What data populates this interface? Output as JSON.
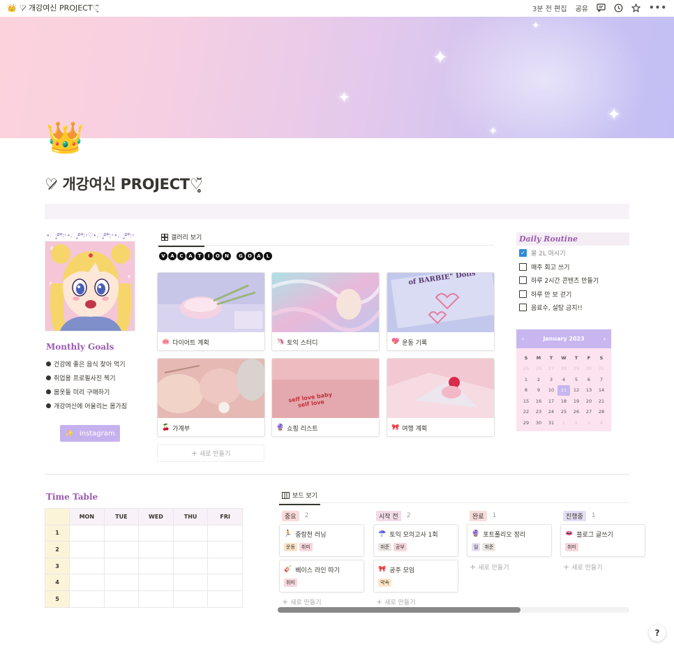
{
  "topbar": {
    "icon": "👑",
    "page_title": "♡̷ 개강여신 PROJECT♡̥̆",
    "edited": "3분 전 편집",
    "share": "공유"
  },
  "page": {
    "icon": "👑",
    "title": "♡̷ 개강여신 PROJECT♡̥̆"
  },
  "deco_line": "⋆.ೃ࿔*:･⋆.ೃ࿔*:･♡⋆.ೃ࿔*:･⋆.ೃ࿔*:･",
  "monthly_goals": {
    "title": "Monthly Goals",
    "items": [
      "건강에 좋은 음식 찾아 먹기",
      "취업용 프로필사진 찍기",
      "봄옷들 미리 구매하기",
      "개강여신에 어울리는 몸가짐"
    ]
  },
  "instagram": {
    "icon": "✨",
    "label": "instagram"
  },
  "gallery": {
    "tab": "갤러리 보기",
    "heading_letters": [
      "V",
      "A",
      "C",
      "A",
      "T",
      "I",
      "O",
      "N",
      " ",
      "G",
      "O",
      "A",
      "L"
    ],
    "cards": [
      {
        "emoji": "🐽",
        "title": "다이어트 계획"
      },
      {
        "emoji": "🦄",
        "title": "토익 스터디"
      },
      {
        "emoji": "💖",
        "title": "운동 기록"
      },
      {
        "emoji": "🍒",
        "title": "가계부"
      },
      {
        "emoji": "🔮",
        "title": "쇼핑 리스트"
      },
      {
        "emoji": "🎀",
        "title": "여행 계획"
      }
    ],
    "new": "새로 만들기",
    "img_text_3": "of BARBIE\" Dolls",
    "img_text_5a": "self love baby",
    "img_text_5b": "self love"
  },
  "routine": {
    "title": "Daily Routine",
    "items": [
      {
        "label": "물 2L 마시기",
        "checked": true
      },
      {
        "label": "매주 회고 쓰기",
        "checked": false
      },
      {
        "label": "하루 2시간 콘텐츠 만들기",
        "checked": false
      },
      {
        "label": "하루 만 보 걷기",
        "checked": false
      },
      {
        "label": "음료수, 설탕 금지!!",
        "checked": false
      }
    ]
  },
  "calendar": {
    "prev": "‹",
    "next": "›",
    "month": "January 2023",
    "dow": [
      "S",
      "M",
      "T",
      "W",
      "T",
      "F",
      "S"
    ],
    "days": [
      {
        "d": "25",
        "m": true
      },
      {
        "d": "26",
        "m": true
      },
      {
        "d": "27",
        "m": true
      },
      {
        "d": "28",
        "m": true
      },
      {
        "d": "29",
        "m": true
      },
      {
        "d": "30",
        "m": true
      },
      {
        "d": "31",
        "m": true
      },
      {
        "d": "1"
      },
      {
        "d": "2"
      },
      {
        "d": "3"
      },
      {
        "d": "4"
      },
      {
        "d": "5"
      },
      {
        "d": "6"
      },
      {
        "d": "7"
      },
      {
        "d": "8"
      },
      {
        "d": "9"
      },
      {
        "d": "10"
      },
      {
        "d": "11",
        "t": true
      },
      {
        "d": "12"
      },
      {
        "d": "13"
      },
      {
        "d": "14"
      },
      {
        "d": "15"
      },
      {
        "d": "16"
      },
      {
        "d": "17"
      },
      {
        "d": "18"
      },
      {
        "d": "19"
      },
      {
        "d": "20"
      },
      {
        "d": "21"
      },
      {
        "d": "22"
      },
      {
        "d": "23"
      },
      {
        "d": "24"
      },
      {
        "d": "25"
      },
      {
        "d": "26"
      },
      {
        "d": "27"
      },
      {
        "d": "28"
      },
      {
        "d": "29"
      },
      {
        "d": "30"
      },
      {
        "d": "31"
      },
      {
        "d": "1",
        "m": true
      },
      {
        "d": "2",
        "m": true
      },
      {
        "d": "3",
        "m": true
      },
      {
        "d": "4",
        "m": true
      }
    ]
  },
  "timetable": {
    "title": "Time Table",
    "days": [
      "MON",
      "TUE",
      "WED",
      "THU",
      "FRI"
    ],
    "rows": [
      "1",
      "2",
      "3",
      "4",
      "5"
    ]
  },
  "board": {
    "tab": "보드 보기",
    "new": "새로 만들기",
    "groups": [
      {
        "label": "중요",
        "count": "2",
        "bg": "#fbdada",
        "cards": [
          {
            "emoji": "🏃",
            "title": "중랑천 러닝",
            "tags": [
              {
                "t": "운동",
                "bg": "#fae3c8"
              },
              {
                "t": "취미",
                "bg": "#f5d6dc"
              }
            ]
          },
          {
            "emoji": "🎸",
            "title": "베이스 라인 따기",
            "tags": [
              {
                "t": "취미",
                "bg": "#f5d6dc"
              }
            ]
          }
        ]
      },
      {
        "label": "시작 전",
        "count": "2",
        "bg": "#f1dce8",
        "cards": [
          {
            "emoji": "☂️",
            "title": "토익 모의고사 1회",
            "tags": [
              {
                "t": "취준",
                "bg": "#ece6e3"
              },
              {
                "t": "공부",
                "bg": "#f5d6dc"
              }
            ]
          },
          {
            "emoji": "🎀",
            "title": "공주 모임",
            "tags": [
              {
                "t": "약속",
                "bg": "#fde6c9"
              }
            ]
          }
        ]
      },
      {
        "label": "완료",
        "count": "1",
        "bg": "#f7dcdc",
        "cards": [
          {
            "emoji": "🔮",
            "title": "포트폴리오 정리",
            "tags": [
              {
                "t": "일",
                "bg": "#e7dff4"
              },
              {
                "t": "취준",
                "bg": "#ece6e3"
              }
            ]
          }
        ]
      },
      {
        "label": "진행중",
        "count": "1",
        "bg": "#e4ddf4",
        "cards": [
          {
            "emoji": "👄",
            "title": "블로그 글쓰기",
            "tags": [
              {
                "t": "취미",
                "bg": "#f5d6dc"
              }
            ]
          }
        ]
      }
    ]
  },
  "help": "?"
}
